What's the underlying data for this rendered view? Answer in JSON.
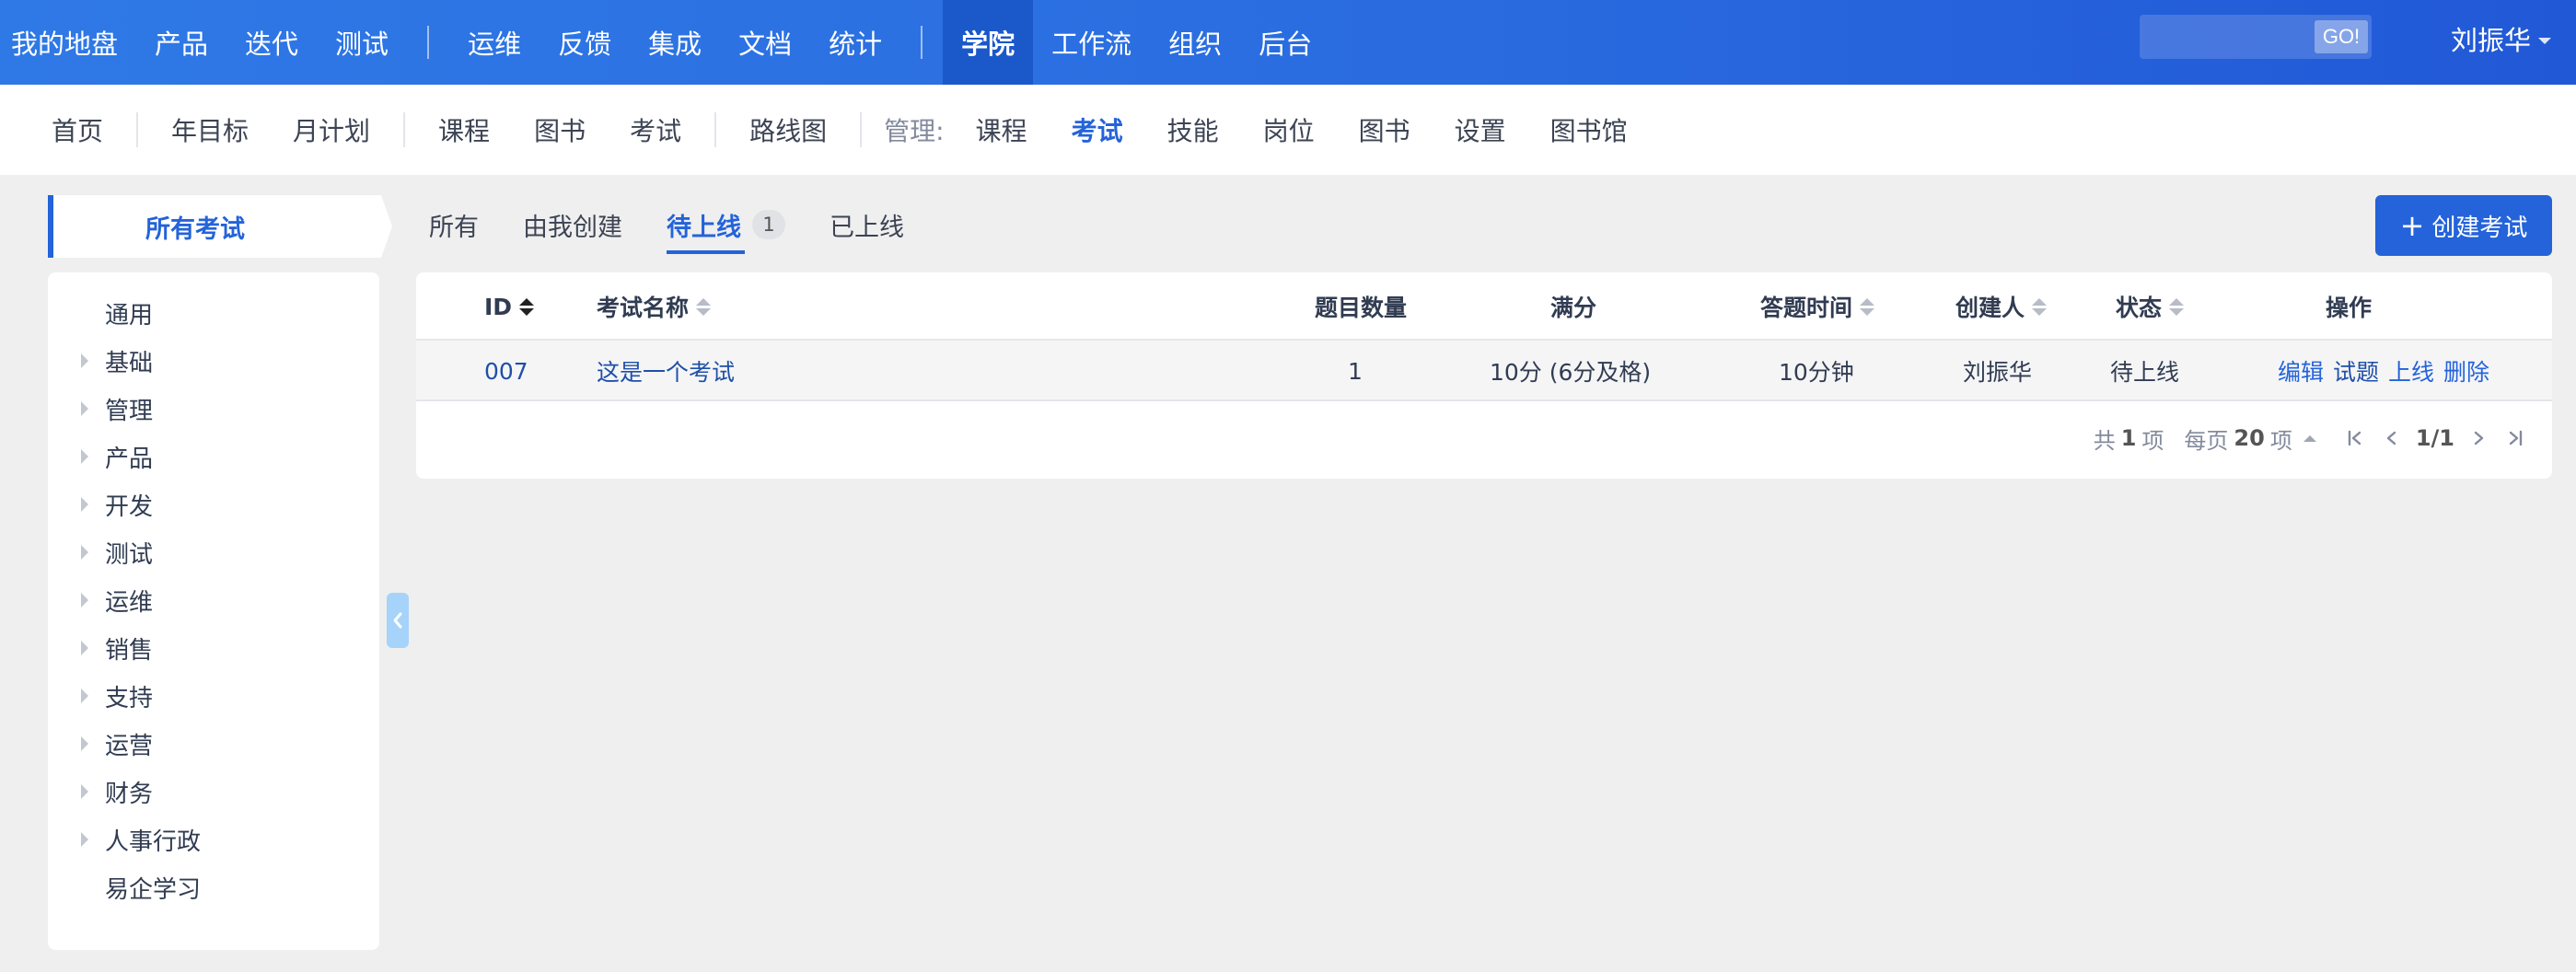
{
  "topnav": {
    "group1": [
      "我的地盘",
      "产品",
      "迭代",
      "测试"
    ],
    "group2": [
      "运维",
      "反馈",
      "集成",
      "文档",
      "统计"
    ],
    "group3": [
      "学院",
      "工作流",
      "组织",
      "后台"
    ],
    "active": "学院"
  },
  "search": {
    "go_label": "GO!",
    "value": ""
  },
  "user": {
    "name": "刘振华"
  },
  "subnav": {
    "group1": [
      "首页"
    ],
    "group2": [
      "年目标",
      "月计划"
    ],
    "group3": [
      "课程",
      "图书",
      "考试"
    ],
    "group4": [
      "路线图"
    ],
    "manage_label": "管理:",
    "manage_items": [
      "课程",
      "考试",
      "技能",
      "岗位",
      "图书",
      "设置",
      "图书馆"
    ],
    "active": "考试"
  },
  "sidebar": {
    "title": "所有考试",
    "items": [
      {
        "label": "通用",
        "expandable": false
      },
      {
        "label": "基础",
        "expandable": true
      },
      {
        "label": "管理",
        "expandable": true
      },
      {
        "label": "产品",
        "expandable": true
      },
      {
        "label": "开发",
        "expandable": true
      },
      {
        "label": "测试",
        "expandable": true
      },
      {
        "label": "运维",
        "expandable": true
      },
      {
        "label": "销售",
        "expandable": true
      },
      {
        "label": "支持",
        "expandable": true
      },
      {
        "label": "运营",
        "expandable": true
      },
      {
        "label": "财务",
        "expandable": true
      },
      {
        "label": "人事行政",
        "expandable": true
      },
      {
        "label": "易企学习",
        "expandable": false
      }
    ]
  },
  "tabs": {
    "all": "所有",
    "mine": "由我创建",
    "pending": "待上线",
    "pending_count": "1",
    "online": "已上线"
  },
  "create_button": {
    "label": "创建考试",
    "icon": "plus-icon"
  },
  "table": {
    "headers": {
      "id": "ID",
      "name": "考试名称",
      "count": "题目数量",
      "score": "满分",
      "time": "答题时间",
      "creator": "创建人",
      "status": "状态",
      "ops": "操作"
    },
    "rows": [
      {
        "id": "007",
        "name": "这是一个考试",
        "count": "1",
        "score": "10分 (6分及格)",
        "time": "10分钟",
        "creator": "刘振华",
        "status": "待上线",
        "actions": [
          "编辑",
          "试题",
          "上线",
          "删除"
        ]
      }
    ]
  },
  "pager": {
    "total_prefix": "共",
    "total": "1",
    "total_suffix": "项",
    "per_prefix": "每页",
    "per": "20",
    "per_suffix": "项",
    "page": "1/1"
  },
  "colors": {
    "primary": "#2463d9",
    "topbar": "#2a6ce0",
    "background": "#efefef"
  }
}
